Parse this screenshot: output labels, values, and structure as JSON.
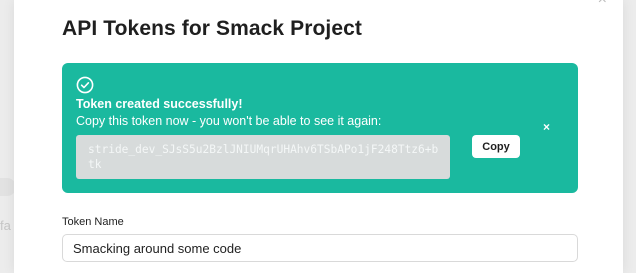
{
  "dialog": {
    "title": "API Tokens for Smack Project",
    "close_glyph": "×"
  },
  "banner": {
    "icon": "check-circle-icon",
    "headline": "Token created successfully!",
    "message": "Copy this token now - you won't be able to see it again:",
    "token": "stride_dev_SJsS5u2BzlJNIUMqrUHAhv6TSbAPo1jF248Ttz6+btk",
    "copy_label": "Copy",
    "dismiss_glyph": "×",
    "color": "#1ab99f"
  },
  "form": {
    "token_name_label": "Token Name",
    "token_name_value": "Smacking around some code"
  },
  "backdrop": {
    "partial_text": "fa"
  }
}
